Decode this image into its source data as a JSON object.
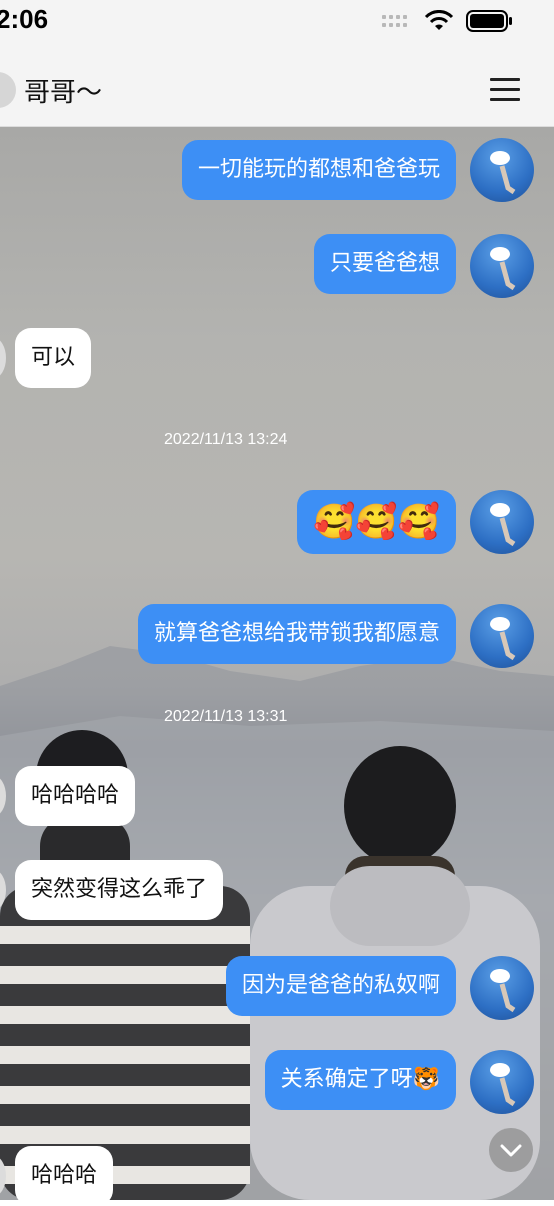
{
  "status": {
    "time": "2:06"
  },
  "header": {
    "title": "哥哥～",
    "menu_icon": "hamburger-menu-icon"
  },
  "messages": [
    {
      "side": "out",
      "text": "一切能玩的都想和爸爸玩"
    },
    {
      "side": "out",
      "text": "只要爸爸想"
    },
    {
      "side": "in",
      "text": "可以"
    },
    {
      "timestamp": "2022/11/13 13:24"
    },
    {
      "side": "out",
      "text": "🥰🥰🥰"
    },
    {
      "side": "out",
      "text": "就算爸爸想给我带锁我都愿意"
    },
    {
      "timestamp": "2022/11/13 13:31"
    },
    {
      "side": "in",
      "text": "哈哈哈哈"
    },
    {
      "side": "in",
      "text": "突然变得这么乖了"
    },
    {
      "side": "out",
      "text": "因为是爸爸的私奴啊"
    },
    {
      "side": "out",
      "text": "关系确定了呀🐯"
    },
    {
      "side": "in",
      "text": "哈哈哈"
    }
  ],
  "colors": {
    "outgoing_bubble": "#3d8ff5",
    "incoming_bubble": "#ffffff"
  }
}
